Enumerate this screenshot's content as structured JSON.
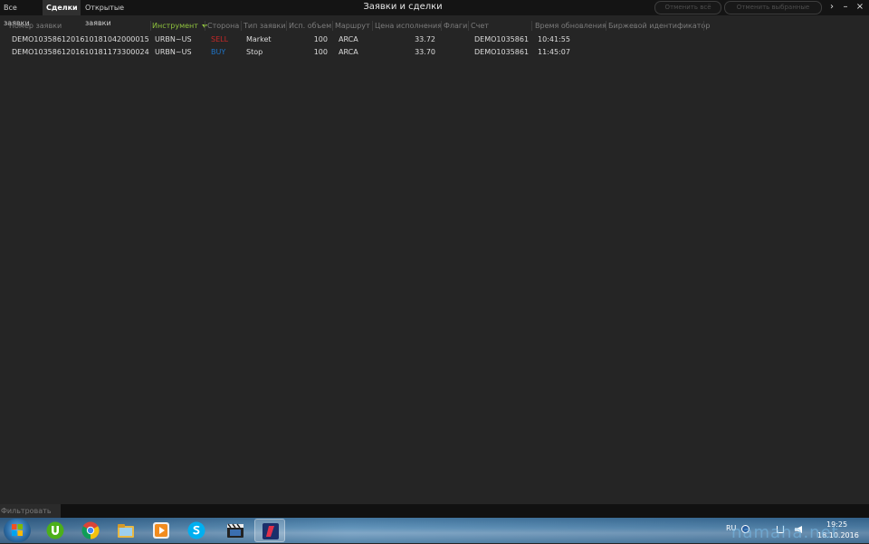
{
  "tabs": [
    "Все заявки",
    "Сделки",
    "Открытые заявки"
  ],
  "active_tab": "Сделки",
  "window_title": "Заявки и сделки",
  "buttons": {
    "cancel_all": "Отменить всё",
    "cancel_selected": "Отменить выбранные"
  },
  "window_controls": {
    "expand": "›",
    "minimize": "–",
    "close": "×"
  },
  "columns": {
    "order_number": "Номер заявки",
    "instrument": "Инструмент",
    "side": "Сторона",
    "order_type": "Тип заявки",
    "filled_qty": "Исп. объем",
    "route": "Маршрут",
    "fill_price": "Цена исполнения",
    "flags": "Флаги",
    "account": "Счет",
    "update_time": "Время обновления",
    "exchange_id": "Биржевой идентификатор"
  },
  "sorted_column": "instrument",
  "rows": [
    {
      "order_number": "DEMO1035861201610181042000015",
      "instrument": "URBN~US",
      "side": "SELL",
      "side_color": "#c62828",
      "order_type": "Market",
      "filled_qty": "100",
      "route": "ARCA",
      "fill_price": "33.72",
      "flags": "",
      "account": "DEMO1035861",
      "update_time": "10:41:55",
      "exchange_id": ""
    },
    {
      "order_number": "DEMO1035861201610181173300024",
      "instrument": "URBN~US",
      "side": "BUY",
      "side_color": "#1e74c8",
      "order_type": "Stop",
      "filled_qty": "100",
      "route": "ARCA",
      "fill_price": "33.70",
      "flags": "",
      "account": "DEMO1035861",
      "update_time": "11:45:07",
      "exchange_id": ""
    }
  ],
  "filter": {
    "label": "Фильтровать по",
    "value": ""
  },
  "taskbar": {
    "apps": [
      "windows-start-icon",
      "utorrent-icon",
      "chrome-icon",
      "file-explorer-icon",
      "media-player-icon",
      "skype-icon",
      "media-classic-icon",
      "trading-app-icon"
    ],
    "language": "RU",
    "time": "19:25",
    "date": "18.10.2016"
  },
  "watermark": "namaha.net",
  "colors": {
    "background": "#252525",
    "titlebar": "#141414",
    "sorted_header": "#8fc33e",
    "sell": "#c62828",
    "buy": "#1e74c8"
  }
}
